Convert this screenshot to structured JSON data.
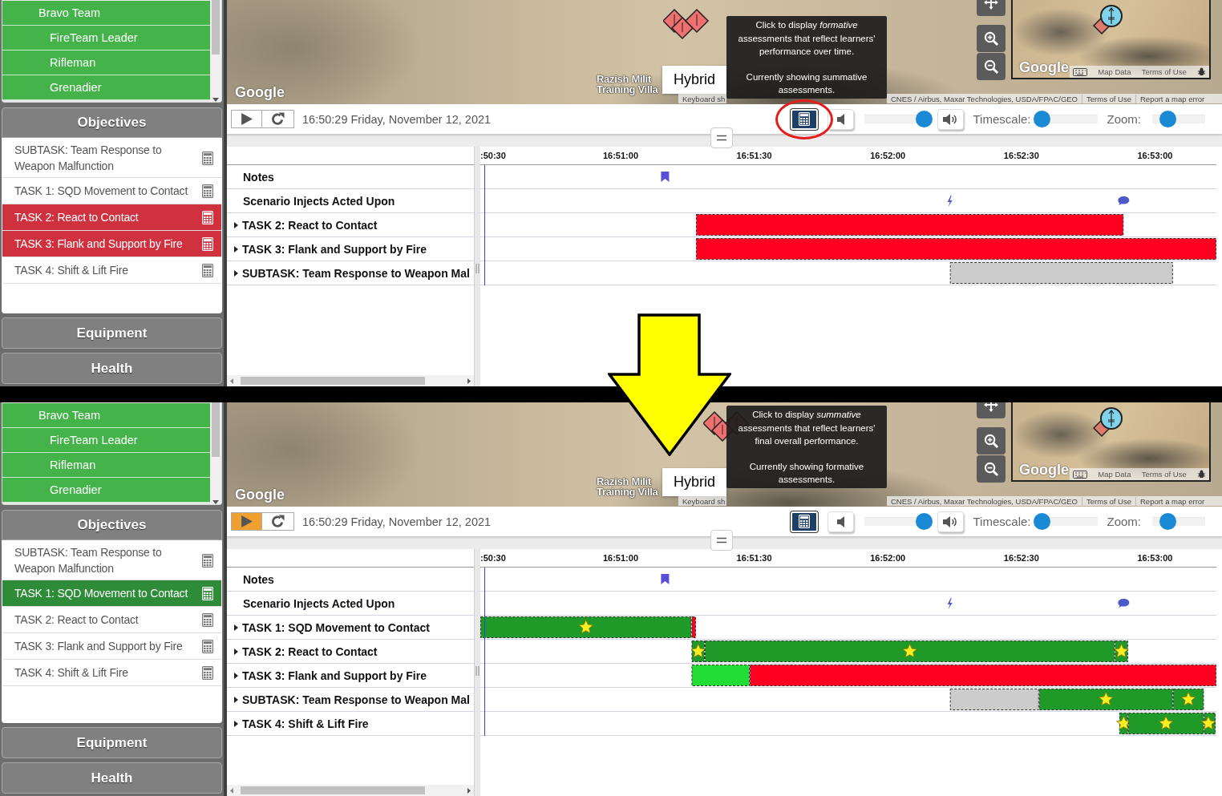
{
  "screens": [
    {
      "sidebar": {
        "units": [
          {
            "label": "Bravo Team",
            "children": [
              {
                "label": "FireTeam Leader"
              },
              {
                "label": "Rifleman"
              },
              {
                "label": "Grenadier"
              }
            ]
          }
        ],
        "objectives_title": "Objectives",
        "objectives": [
          {
            "label": "SUBTASK: Team Response to Weapon Malfunction",
            "color": "#ffffff"
          },
          {
            "label": "TASK 1: SQD Movement to Contact",
            "color": "#ffffff"
          },
          {
            "label": "TASK 2: React to Contact",
            "color": "#d0313f"
          },
          {
            "label": "TASK 3: Flank and Support by Fire",
            "color": "#d0313f"
          },
          {
            "label": "TASK 4: Shift & Lift Fire",
            "color": "#ffffff"
          }
        ],
        "sections": [
          "Equipment",
          "Health"
        ]
      },
      "map": {
        "google_logo": "Google",
        "place_label": [
          "Razish Milit",
          "Training Villa"
        ],
        "map_type_button": "Hybrid",
        "attribution": [
          "Keyboard sh",
          "CNES / Airbus, Maxar Technologies, USDA/FPAC/GEO",
          "Terms of Use",
          "Report a map error"
        ],
        "minimap": {
          "google_logo": "Google",
          "links": [
            "Map Data",
            "Terms of Use"
          ]
        },
        "tooltip": {
          "text": "Click to display *formative* assessments that reflect learners' performance over time.",
          "status": "Currently showing summative assessments."
        }
      },
      "toolbar": {
        "playing": false,
        "timestamp": "16:50:29 Friday, November 12, 2021",
        "assessment_button": {
          "circled": true
        },
        "volume": {
          "level": 0.9
        },
        "timescale": {
          "label": "Timescale:",
          "level": 0.11
        },
        "zoom": {
          "label": "Zoom:",
          "level": 0.3
        }
      },
      "timeline": {
        "ticks": [
          ":50:30",
          "16:51:00",
          "16:51:30",
          "16:52:00",
          "16:52:30",
          "16:53:00"
        ],
        "rows": [
          {
            "kind": "notes",
            "label": "Notes",
            "markers": [
              {
                "kind": "bookmark",
                "level": 0.251
              }
            ]
          },
          {
            "kind": "injects",
            "label": "Scenario Injects Acted Upon",
            "markers": [
              {
                "kind": "lightning",
                "level": 0.638
              },
              {
                "kind": "chat",
                "level": 0.874
              }
            ]
          },
          {
            "kind": "task",
            "label": "TASK 2: React to Contact",
            "expanded": false
          },
          {
            "kind": "task",
            "label": "TASK 3: Flank and Support by Fire",
            "expanded": false
          },
          {
            "kind": "task",
            "label": "SUBTASK: Team Response to Weapon Mal",
            "expanded": false
          }
        ]
      }
    },
    {
      "sidebar": {
        "units": [
          {
            "label": "Bravo Team",
            "children": [
              {
                "label": "FireTeam Leader"
              },
              {
                "label": "Rifleman"
              },
              {
                "label": "Grenadier"
              }
            ]
          }
        ],
        "objectives_title": "Objectives",
        "objectives": [
          {
            "label": "SUBTASK: Team Response to Weapon Malfunction",
            "color": "#ffffff"
          },
          {
            "label": "TASK 1: SQD Movement to Contact",
            "color": "#2e8b37"
          },
          {
            "label": "TASK 2: React to Contact",
            "color": "#ffffff"
          },
          {
            "label": "TASK 3: Flank and Support by Fire",
            "color": "#ffffff"
          },
          {
            "label": "TASK 4: Shift & Lift Fire",
            "color": "#ffffff"
          }
        ],
        "sections": [
          "Equipment",
          "Health"
        ]
      },
      "map": {
        "google_logo": "Google",
        "place_label": [
          "Razish Milit",
          "Training Villa"
        ],
        "map_type_button": "Hybrid",
        "attribution": [
          "Keyboard sh",
          "CNES / Airbus, Maxar Technologies, USDA/FPAC/GEO",
          "Terms of Use",
          "Report a map error"
        ],
        "minimap": {
          "google_logo": "Google",
          "links": [
            "Map Data",
            "Terms of Use"
          ]
        },
        "tooltip": {
          "text": "Click to display *summative* assessments that reflect learners' final overall performance.",
          "status": "Currently showing formative assessments."
        }
      },
      "toolbar": {
        "playing": true,
        "timestamp": "16:50:29 Friday, November 12, 2021",
        "assessment_button": {
          "circled": false
        },
        "volume": {
          "level": 0.9
        },
        "timescale": {
          "label": "Timescale:",
          "level": 0.11
        },
        "zoom": {
          "label": "Zoom:",
          "level": 0.3
        }
      },
      "timeline": {
        "ticks": [
          ":50:30",
          "16:51:00",
          "16:51:30",
          "16:52:00",
          "16:52:30",
          "16:53:00"
        ],
        "rows": [
          {
            "kind": "notes",
            "label": "Notes",
            "markers": [
              {
                "kind": "bookmark",
                "level": 0.251
              }
            ]
          },
          {
            "kind": "injects",
            "label": "Scenario Injects Acted Upon",
            "markers": [
              {
                "kind": "lightning",
                "level": 0.638
              },
              {
                "kind": "chat",
                "level": 0.874
              }
            ]
          },
          {
            "kind": "task",
            "label": "TASK 1: SQD Movement to Contact",
            "expanded": false
          },
          {
            "kind": "task",
            "label": "TASK 2: React to Contact",
            "expanded": false
          },
          {
            "kind": "task",
            "label": "TASK 3: Flank and Support by Fire",
            "expanded": false
          },
          {
            "kind": "task",
            "label": "SUBTASK: Team Response to Weapon Mal",
            "expanded": false
          },
          {
            "kind": "task",
            "label": "TASK 4: Shift & Lift Fire",
            "expanded": false
          }
        ]
      }
    }
  ]
}
